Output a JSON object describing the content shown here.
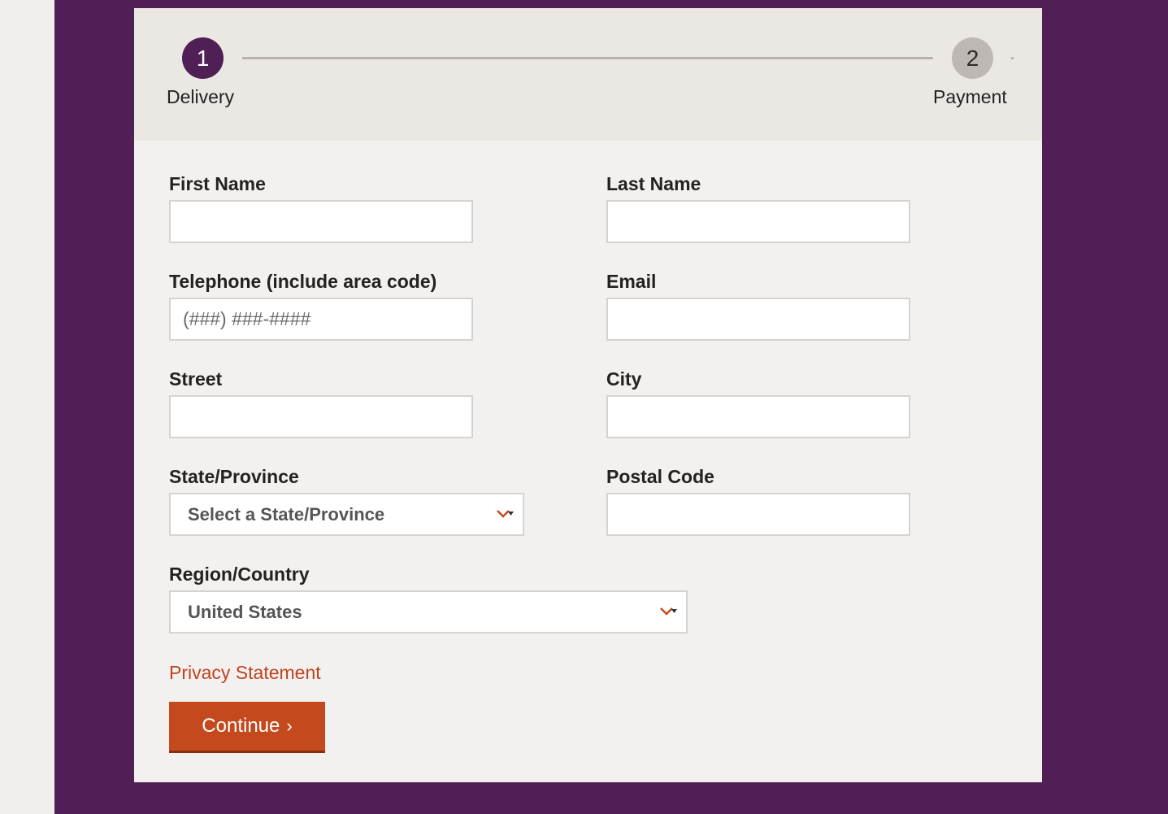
{
  "stepper": {
    "steps": [
      {
        "number": "1",
        "label": "Delivery",
        "state": "active"
      },
      {
        "number": "2",
        "label": "Payment",
        "state": "inactive"
      }
    ]
  },
  "form": {
    "first_name": {
      "label": "First Name",
      "value": "",
      "placeholder": ""
    },
    "last_name": {
      "label": "Last Name",
      "value": "",
      "placeholder": ""
    },
    "telephone": {
      "label": "Telephone (include area code)",
      "value": "",
      "placeholder": "(###) ###-####"
    },
    "email": {
      "label": "Email",
      "value": "",
      "placeholder": ""
    },
    "street": {
      "label": "Street",
      "value": "",
      "placeholder": ""
    },
    "city": {
      "label": "City",
      "value": "",
      "placeholder": ""
    },
    "state": {
      "label": "State/Province",
      "selected": "Select a State/Province"
    },
    "postal_code": {
      "label": "Postal Code",
      "value": "",
      "placeholder": ""
    },
    "country": {
      "label": "Region/Country",
      "selected": "United States"
    }
  },
  "privacy_link": "Privacy Statement",
  "continue_button": {
    "label": "Continue",
    "arrow": "›"
  },
  "icons": {
    "chevron": "chevron-down-icon"
  },
  "colors": {
    "brand_purple": "#4f1f56",
    "accent_orange": "#c44a1d",
    "link_orange": "#c0431e",
    "step_inactive": "#bdb8b3"
  }
}
